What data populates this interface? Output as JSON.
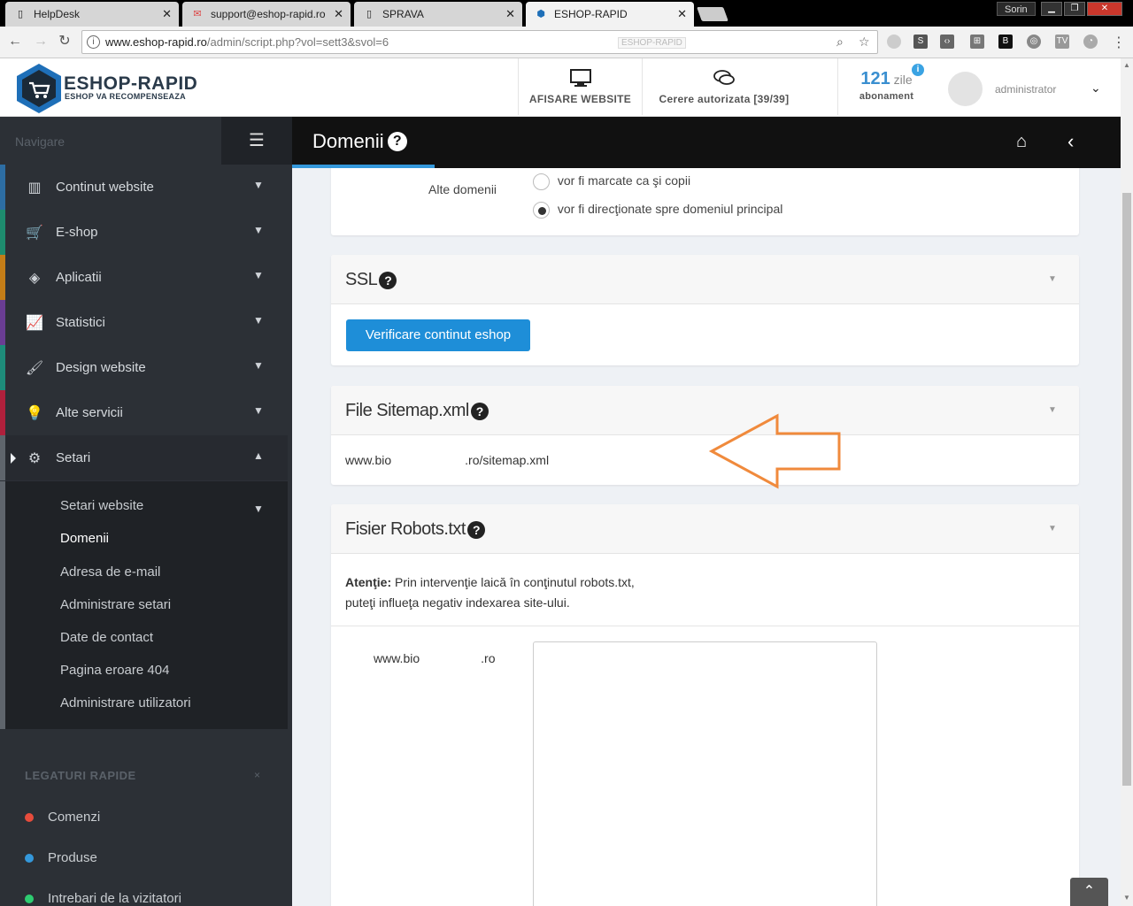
{
  "browser": {
    "tabs": [
      {
        "title": "HelpDesk",
        "favicon": "page-icon"
      },
      {
        "title": "support@eshop-rapid.ro",
        "favicon": "gmail-icon"
      },
      {
        "title": "SPRAVA",
        "favicon": "page-icon"
      },
      {
        "title": "ESHOP-RAPID",
        "favicon": "eshop-hex-icon",
        "active": true
      }
    ],
    "user": "Sorin",
    "url_host": "www.eshop-rapid.ro",
    "url_path": "/admin/script.php?vol=sett3&svol=6",
    "omni_tooltip": "ESHOP-RAPID"
  },
  "header": {
    "logo_title": "ESHOP-RAPID",
    "logo_subtitle": "ESHOP VA RECOMPENSEAZA",
    "website_btn": "AFISARE WEBSITE",
    "request_btn": "Cerere autorizata [39/39]",
    "days_count": "121",
    "days_unit": "zile",
    "subscription_label": "abonament",
    "info_badge": "i",
    "admin_name": "administrator"
  },
  "sidebar": {
    "nav_label": "Navigare",
    "items": [
      {
        "label": "Continut website",
        "icon": "columns-icon",
        "color": "#2d6da3"
      },
      {
        "label": "E-shop",
        "icon": "basket-icon",
        "color": "#1e8c6e"
      },
      {
        "label": "Aplicatii",
        "icon": "cubes-icon",
        "color": "#c47d18"
      },
      {
        "label": "Statistici",
        "icon": "line-chart-icon",
        "color": "#6a3d93"
      },
      {
        "label": "Design website",
        "icon": "brush-icon",
        "color": "#1e8c7a"
      },
      {
        "label": "Alte servicii",
        "icon": "bulb-icon",
        "color": "#b0203c"
      },
      {
        "label": "Setari",
        "icon": "gears-icon",
        "color": "#5f656c"
      }
    ],
    "sub_items": [
      {
        "label": "Setari website"
      },
      {
        "label": "Domenii",
        "active": true
      },
      {
        "label": "Adresa de e-mail"
      },
      {
        "label": "Administrare setari"
      },
      {
        "label": "Date de contact"
      },
      {
        "label": "Pagina eroare 404"
      },
      {
        "label": "Administrare utilizatori"
      }
    ],
    "quick_title": "LEGATURI RAPIDE",
    "quick_close": "×",
    "quick_links": [
      {
        "label": "Comenzi",
        "color": "#e74c3c"
      },
      {
        "label": "Produse",
        "color": "#3498db"
      },
      {
        "label": "Intrebari de la vizitatori",
        "color": "#2ecc71"
      }
    ]
  },
  "page": {
    "title": "Domenii",
    "help_icon": "?"
  },
  "domains_card": {
    "label": "Alte domenii",
    "options": [
      {
        "label": "vor fi marcate ca şi copii",
        "selected": false
      },
      {
        "label": "vor fi direcţionate spre domeniul principal",
        "selected": true
      }
    ]
  },
  "ssl_card": {
    "title": "SSL",
    "button": "Verificare continut eshop"
  },
  "sitemap_card": {
    "title": "File Sitemap.xml",
    "url_start": "www.bio",
    "url_end": ".ro/sitemap.xml"
  },
  "robots_card": {
    "title": "Fisier Robots.txt",
    "warning_bold": "Atenţie:",
    "warning_text": " Prin intervenţie laică în conţinutul robots.txt,",
    "warning_line2": "puteţi influeţa negativ indexarea site-ului.",
    "domain_start": "www.bio",
    "domain_end": ".ro"
  },
  "colors": {
    "accent": "#3498db",
    "button": "#1e8ed8",
    "annotation_arrow": "#f08a3c"
  }
}
